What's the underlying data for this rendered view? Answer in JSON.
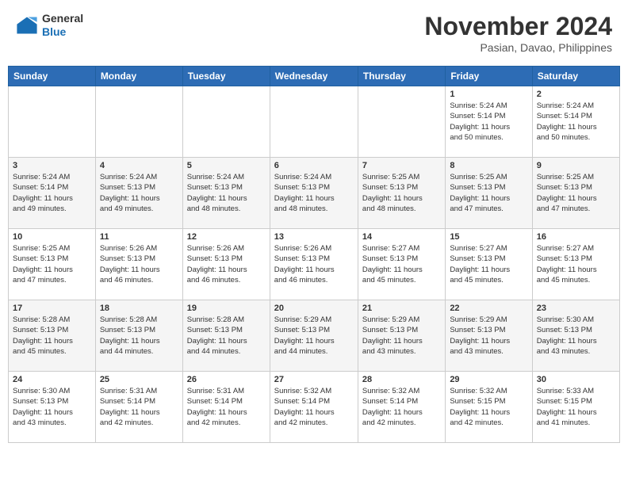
{
  "header": {
    "logo": {
      "general": "General",
      "blue": "Blue"
    },
    "title": "November 2024",
    "location": "Pasian, Davao, Philippines"
  },
  "days_of_week": [
    "Sunday",
    "Monday",
    "Tuesday",
    "Wednesday",
    "Thursday",
    "Friday",
    "Saturday"
  ],
  "weeks": [
    [
      {
        "day": "",
        "info": ""
      },
      {
        "day": "",
        "info": ""
      },
      {
        "day": "",
        "info": ""
      },
      {
        "day": "",
        "info": ""
      },
      {
        "day": "",
        "info": ""
      },
      {
        "day": "1",
        "info": "Sunrise: 5:24 AM\nSunset: 5:14 PM\nDaylight: 11 hours\nand 50 minutes."
      },
      {
        "day": "2",
        "info": "Sunrise: 5:24 AM\nSunset: 5:14 PM\nDaylight: 11 hours\nand 50 minutes."
      }
    ],
    [
      {
        "day": "3",
        "info": "Sunrise: 5:24 AM\nSunset: 5:14 PM\nDaylight: 11 hours\nand 49 minutes."
      },
      {
        "day": "4",
        "info": "Sunrise: 5:24 AM\nSunset: 5:13 PM\nDaylight: 11 hours\nand 49 minutes."
      },
      {
        "day": "5",
        "info": "Sunrise: 5:24 AM\nSunset: 5:13 PM\nDaylight: 11 hours\nand 48 minutes."
      },
      {
        "day": "6",
        "info": "Sunrise: 5:24 AM\nSunset: 5:13 PM\nDaylight: 11 hours\nand 48 minutes."
      },
      {
        "day": "7",
        "info": "Sunrise: 5:25 AM\nSunset: 5:13 PM\nDaylight: 11 hours\nand 48 minutes."
      },
      {
        "day": "8",
        "info": "Sunrise: 5:25 AM\nSunset: 5:13 PM\nDaylight: 11 hours\nand 47 minutes."
      },
      {
        "day": "9",
        "info": "Sunrise: 5:25 AM\nSunset: 5:13 PM\nDaylight: 11 hours\nand 47 minutes."
      }
    ],
    [
      {
        "day": "10",
        "info": "Sunrise: 5:25 AM\nSunset: 5:13 PM\nDaylight: 11 hours\nand 47 minutes."
      },
      {
        "day": "11",
        "info": "Sunrise: 5:26 AM\nSunset: 5:13 PM\nDaylight: 11 hours\nand 46 minutes."
      },
      {
        "day": "12",
        "info": "Sunrise: 5:26 AM\nSunset: 5:13 PM\nDaylight: 11 hours\nand 46 minutes."
      },
      {
        "day": "13",
        "info": "Sunrise: 5:26 AM\nSunset: 5:13 PM\nDaylight: 11 hours\nand 46 minutes."
      },
      {
        "day": "14",
        "info": "Sunrise: 5:27 AM\nSunset: 5:13 PM\nDaylight: 11 hours\nand 45 minutes."
      },
      {
        "day": "15",
        "info": "Sunrise: 5:27 AM\nSunset: 5:13 PM\nDaylight: 11 hours\nand 45 minutes."
      },
      {
        "day": "16",
        "info": "Sunrise: 5:27 AM\nSunset: 5:13 PM\nDaylight: 11 hours\nand 45 minutes."
      }
    ],
    [
      {
        "day": "17",
        "info": "Sunrise: 5:28 AM\nSunset: 5:13 PM\nDaylight: 11 hours\nand 45 minutes."
      },
      {
        "day": "18",
        "info": "Sunrise: 5:28 AM\nSunset: 5:13 PM\nDaylight: 11 hours\nand 44 minutes."
      },
      {
        "day": "19",
        "info": "Sunrise: 5:28 AM\nSunset: 5:13 PM\nDaylight: 11 hours\nand 44 minutes."
      },
      {
        "day": "20",
        "info": "Sunrise: 5:29 AM\nSunset: 5:13 PM\nDaylight: 11 hours\nand 44 minutes."
      },
      {
        "day": "21",
        "info": "Sunrise: 5:29 AM\nSunset: 5:13 PM\nDaylight: 11 hours\nand 43 minutes."
      },
      {
        "day": "22",
        "info": "Sunrise: 5:29 AM\nSunset: 5:13 PM\nDaylight: 11 hours\nand 43 minutes."
      },
      {
        "day": "23",
        "info": "Sunrise: 5:30 AM\nSunset: 5:13 PM\nDaylight: 11 hours\nand 43 minutes."
      }
    ],
    [
      {
        "day": "24",
        "info": "Sunrise: 5:30 AM\nSunset: 5:13 PM\nDaylight: 11 hours\nand 43 minutes."
      },
      {
        "day": "25",
        "info": "Sunrise: 5:31 AM\nSunset: 5:14 PM\nDaylight: 11 hours\nand 42 minutes."
      },
      {
        "day": "26",
        "info": "Sunrise: 5:31 AM\nSunset: 5:14 PM\nDaylight: 11 hours\nand 42 minutes."
      },
      {
        "day": "27",
        "info": "Sunrise: 5:32 AM\nSunset: 5:14 PM\nDaylight: 11 hours\nand 42 minutes."
      },
      {
        "day": "28",
        "info": "Sunrise: 5:32 AM\nSunset: 5:14 PM\nDaylight: 11 hours\nand 42 minutes."
      },
      {
        "day": "29",
        "info": "Sunrise: 5:32 AM\nSunset: 5:15 PM\nDaylight: 11 hours\nand 42 minutes."
      },
      {
        "day": "30",
        "info": "Sunrise: 5:33 AM\nSunset: 5:15 PM\nDaylight: 11 hours\nand 41 minutes."
      }
    ]
  ]
}
